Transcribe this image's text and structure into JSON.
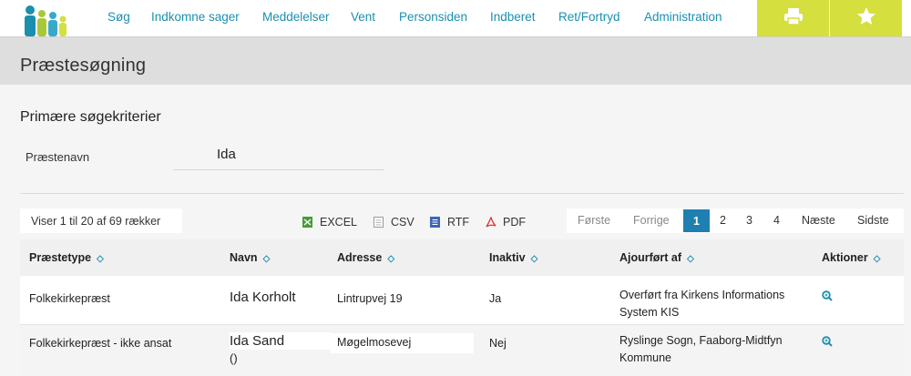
{
  "topbar": {
    "nav": [
      {
        "label": "Søg"
      },
      {
        "label": "Indkomne sager"
      },
      {
        "label": "Meddelelser"
      },
      {
        "label": "Vent"
      },
      {
        "label": "Personsiden"
      },
      {
        "label": "Indberet"
      },
      {
        "label": "Ret/Fortryd"
      },
      {
        "label": "Administration"
      }
    ],
    "print_icon": "printer-icon",
    "favorite_icon": "star-icon",
    "accent_color": "#d5df3e",
    "link_color": "#1b8fae"
  },
  "page": {
    "title": "Præstesøgning"
  },
  "search": {
    "heading": "Primære søgekriterier",
    "field_label": "Præstenavn",
    "field_value": "Ida"
  },
  "results": {
    "summary": "Viser 1 til 20 af 69 rækker",
    "exports": [
      {
        "label": "EXCEL",
        "icon": "excel-icon"
      },
      {
        "label": "CSV",
        "icon": "csv-icon"
      },
      {
        "label": "RTF",
        "icon": "rtf-icon"
      },
      {
        "label": "PDF",
        "icon": "pdf-icon"
      }
    ],
    "pagination": {
      "first": "Første",
      "prev": "Forrige",
      "pages": [
        "1",
        "2",
        "3",
        "4"
      ],
      "current": "1",
      "next": "Næste",
      "last": "Sidste"
    },
    "columns": [
      "Præstetype",
      "Navn",
      "Adresse",
      "Inaktiv",
      "Ajourført af",
      "Aktioner"
    ],
    "rows": [
      {
        "type": "Folkekirkepræst",
        "name": "Ida Korholt",
        "address": "Lintrupvej 19",
        "inactive": "Ja",
        "updated_by": [
          "Overført fra Kirkens Informations",
          "System KIS"
        ]
      },
      {
        "type": "Folkekirkepræst - ikke ansat",
        "name": "Ida Sand",
        "name_extra": "()",
        "address": "Møgelmosevej",
        "inactive": "Nej",
        "updated_by": [
          "Ryslinge Sogn, Faaborg-Midtfyn",
          "Kommune"
        ]
      }
    ]
  }
}
